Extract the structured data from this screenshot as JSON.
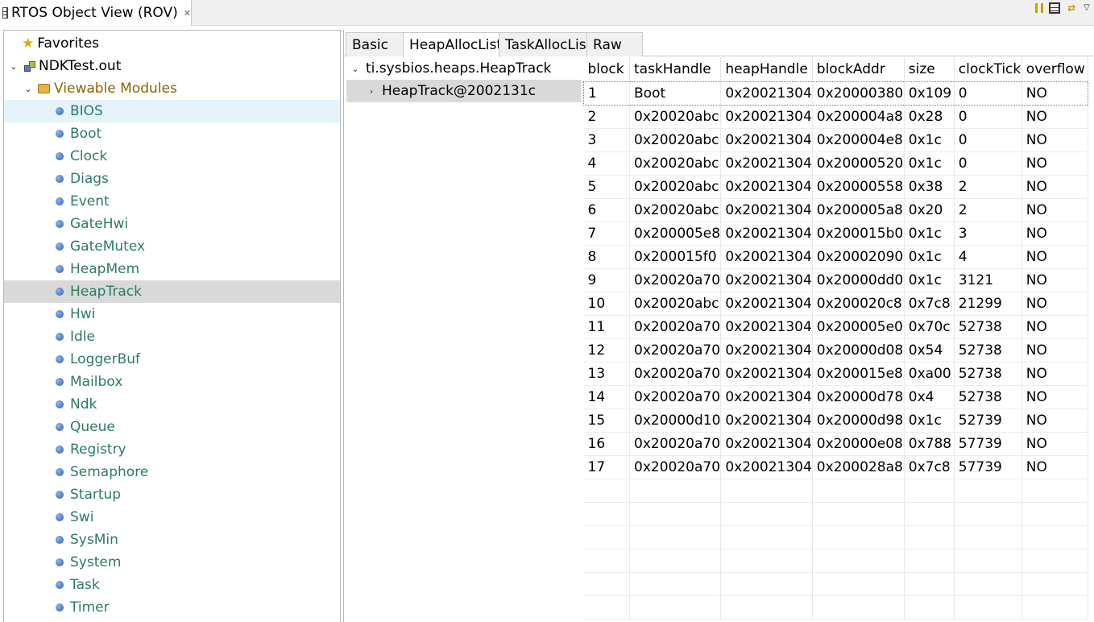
{
  "view": {
    "title": "RTOS Object View (ROV)",
    "close_glyph": "✕",
    "icons": [
      "grid-icon",
      "pause-icon",
      "film-icon",
      "sync-icon",
      "view-menu-icon"
    ]
  },
  "tree": {
    "favorites": "Favorites",
    "program": "NDKTest.out",
    "folder": "Viewable Modules",
    "modules": [
      "BIOS",
      "Boot",
      "Clock",
      "Diags",
      "Event",
      "GateHwi",
      "GateMutex",
      "HeapMem",
      "HeapTrack",
      "Hwi",
      "Idle",
      "LoggerBuf",
      "Mailbox",
      "Ndk",
      "Queue",
      "Registry",
      "Semaphore",
      "Startup",
      "Swi",
      "SysMin",
      "System",
      "Task",
      "Timer"
    ],
    "hovered_module": "BIOS",
    "selected_module": "HeapTrack"
  },
  "tabs": [
    "Basic",
    "HeapAllocList",
    "TaskAllocList",
    "Raw"
  ],
  "active_tab": "HeapAllocList",
  "instances": {
    "module": "ti.sysbios.heaps.HeapTrack",
    "instance": "HeapTrack@2002131c"
  },
  "table": {
    "columns": [
      "block",
      "taskHandle",
      "heapHandle",
      "blockAddr",
      "size",
      "clockTick",
      "overflow"
    ],
    "rows": [
      [
        "1",
        "Boot",
        "0x20021304",
        "0x20000380",
        "0x109",
        "0",
        "NO"
      ],
      [
        "2",
        "0x20020abc",
        "0x20021304",
        "0x200004a8",
        "0x28",
        "0",
        "NO"
      ],
      [
        "3",
        "0x20020abc",
        "0x20021304",
        "0x200004e8",
        "0x1c",
        "0",
        "NO"
      ],
      [
        "4",
        "0x20020abc",
        "0x20021304",
        "0x20000520",
        "0x1c",
        "0",
        "NO"
      ],
      [
        "5",
        "0x20020abc",
        "0x20021304",
        "0x20000558",
        "0x38",
        "2",
        "NO"
      ],
      [
        "6",
        "0x20020abc",
        "0x20021304",
        "0x200005a8",
        "0x20",
        "2",
        "NO"
      ],
      [
        "7",
        "0x200005e8",
        "0x20021304",
        "0x200015b0",
        "0x1c",
        "3",
        "NO"
      ],
      [
        "8",
        "0x200015f0",
        "0x20021304",
        "0x20002090",
        "0x1c",
        "4",
        "NO"
      ],
      [
        "9",
        "0x20020a70",
        "0x20021304",
        "0x20000dd0",
        "0x1c",
        "3121",
        "NO"
      ],
      [
        "10",
        "0x20020abc",
        "0x20021304",
        "0x200020c8",
        "0x7c8",
        "21299",
        "NO"
      ],
      [
        "11",
        "0x20020a70",
        "0x20021304",
        "0x200005e0",
        "0x70c",
        "52738",
        "NO"
      ],
      [
        "12",
        "0x20020a70",
        "0x20021304",
        "0x20000d08",
        "0x54",
        "52738",
        "NO"
      ],
      [
        "13",
        "0x20020a70",
        "0x20021304",
        "0x200015e8",
        "0xa00",
        "52738",
        "NO"
      ],
      [
        "14",
        "0x20020a70",
        "0x20021304",
        "0x20000d78",
        "0x4",
        "52738",
        "NO"
      ],
      [
        "15",
        "0x20000d10",
        "0x20021304",
        "0x20000d98",
        "0x1c",
        "52739",
        "NO"
      ],
      [
        "16",
        "0x20020a70",
        "0x20021304",
        "0x20000e08",
        "0x788",
        "57739",
        "NO"
      ],
      [
        "17",
        "0x20020a70",
        "0x20021304",
        "0x200028a8",
        "0x7c8",
        "57739",
        "NO"
      ]
    ]
  }
}
